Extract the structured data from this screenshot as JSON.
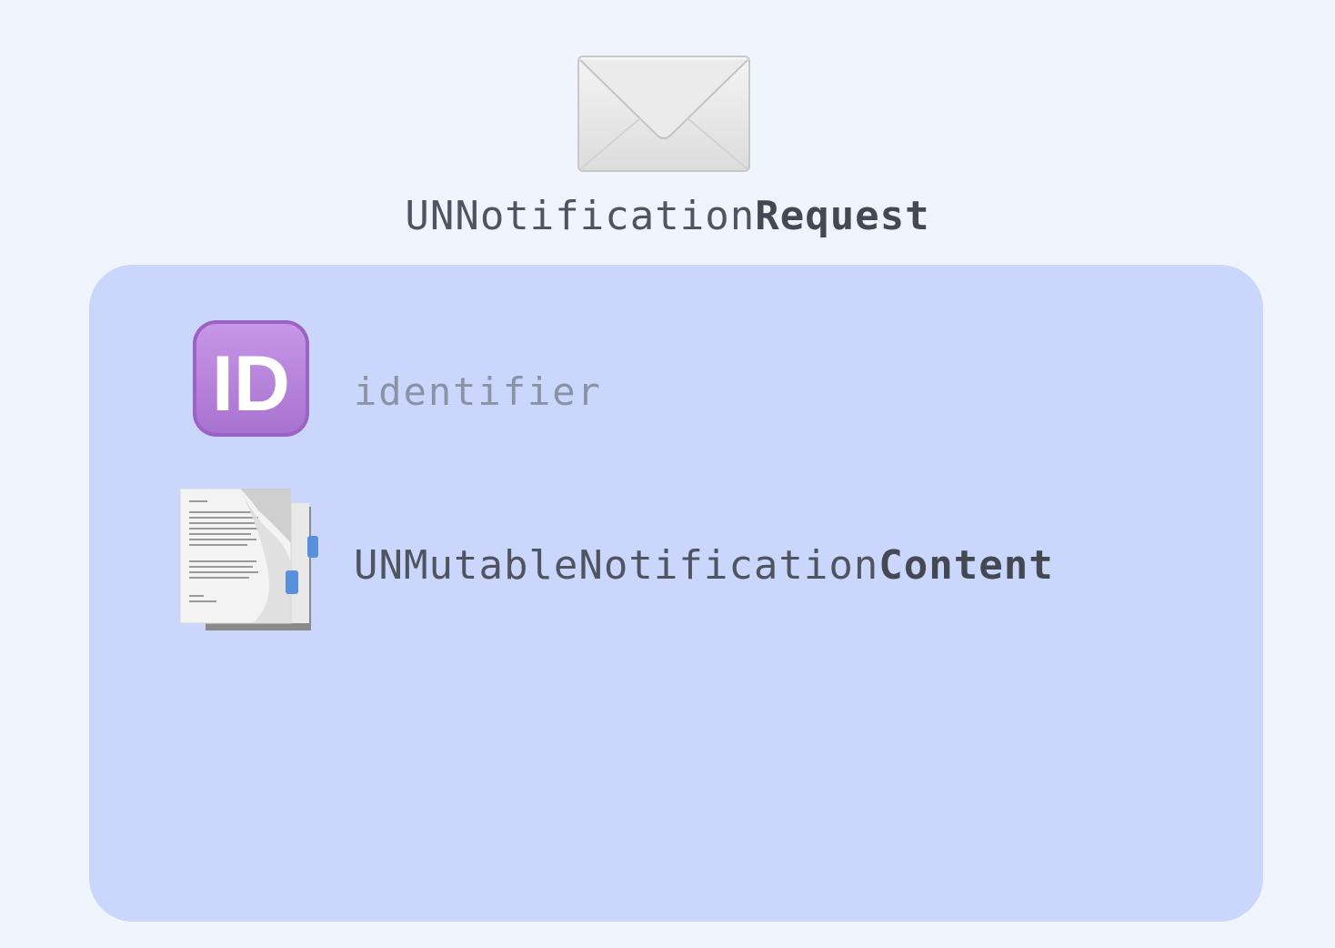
{
  "header": {
    "title_prefix": "UNNotification",
    "title_emphasis": "Request",
    "icon": "envelope-icon"
  },
  "panel": {
    "fields": [
      {
        "icon": "id-icon",
        "badge_text": "ID",
        "label": "identifier"
      },
      {
        "icon": "document-icon",
        "label_prefix": "UNMutableNotification",
        "label_emphasis": "Content"
      }
    ]
  },
  "colors": {
    "background": "#eff4fd",
    "panel": "#cad6fb",
    "id_badge": "#b685d9",
    "text_dark": "#4f5560",
    "text_muted": "#8a92a6"
  }
}
